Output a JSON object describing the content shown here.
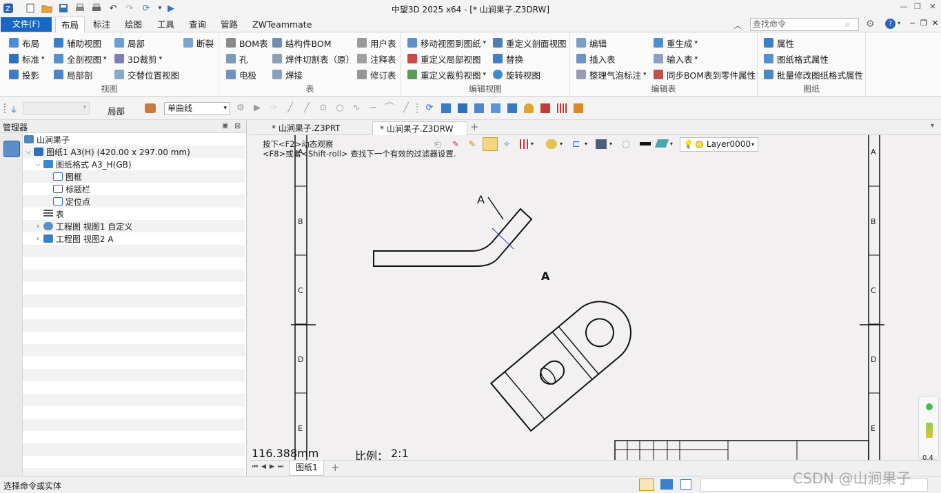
{
  "window": {
    "title": "中望3D 2025 x64 - [* 山涧果子.Z3DRW]"
  },
  "menu": {
    "file": "文件(F)",
    "tabs": [
      "布局",
      "标注",
      "绘图",
      "工具",
      "查询",
      "管路",
      "ZWTeammate"
    ],
    "active_tab": "布局",
    "search_placeholder": "查找命令"
  },
  "ribbon": {
    "view_group": {
      "label": "视图",
      "items": [
        "布局",
        "辅助视图",
        "局部",
        "断裂",
        "标准",
        "全剖视图",
        "3D裁剪",
        "投影",
        "局部剖",
        "交替位置视图"
      ]
    },
    "table_group": {
      "label": "表",
      "items": [
        "BOM表",
        "结构件BOM",
        "用户表",
        "孔",
        "焊件切割表（原）",
        "注释表",
        "电极",
        "焊接",
        "修订表"
      ]
    },
    "editview_group": {
      "label": "编辑视图",
      "items": [
        "移动视图到图纸",
        "重定义剖面视图",
        "重定义局部视图",
        "替换",
        "重定义裁剪视图",
        "旋转视图"
      ]
    },
    "edittable_group": {
      "label": "编辑表",
      "items": [
        "编辑",
        "重生成",
        "插入表",
        "输入表",
        "整理气泡标注",
        "同步BOM表到零件属性"
      ]
    },
    "sheet_group": {
      "label": "图纸",
      "items": [
        "属性",
        "图纸格式属性",
        "批量修改图纸格式属性"
      ]
    }
  },
  "toolbar2": {
    "filter_label": "局部",
    "curve_select": "单曲线"
  },
  "manager": {
    "title": "管理器",
    "tree": [
      "山涧果子",
      "图纸1 A3(H) (420.00 x 297.00 mm)",
      "图纸格式 A3_H(GB)",
      "图框",
      "标题栏",
      "定位点",
      "表",
      "工程图 视图1 自定义",
      "工程图 视图2 A"
    ]
  },
  "doc_tabs": [
    "* 山涧果子.Z3PRT",
    "* 山涧果子.Z3DRW"
  ],
  "active_doc": "* 山涧果子.Z3DRW",
  "canvas": {
    "hint1": "按下<F2>动态观察",
    "hint2": "<F8>或者<Shift-roll> 查找下一个有效的过滤器设置.",
    "layer": "Layer0000",
    "view_label_top": "A",
    "view_label_main": "A",
    "zone_letters": [
      "A",
      "B",
      "C",
      "D",
      "E"
    ],
    "measure": "116.388mm",
    "scale_label": "比例：",
    "scale_value": "2:1"
  },
  "pagebar": {
    "sheet_tab": "图纸1"
  },
  "status": {
    "prompt": "选择命令或实体"
  },
  "watermark": "CSDN @山涧果子",
  "perf": {
    "value": "0.4"
  }
}
